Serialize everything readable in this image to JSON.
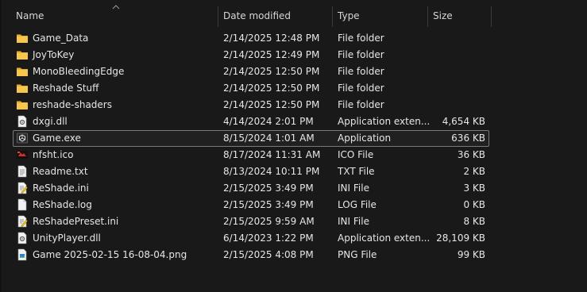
{
  "columns": {
    "name": "Name",
    "date": "Date modified",
    "type": "Type",
    "size": "Size"
  },
  "files": [
    {
      "name": "Game_Data",
      "date": "2/14/2025 12:48 PM",
      "type": "File folder",
      "size": "",
      "icon": "folder-icon"
    },
    {
      "name": "JoyToKey",
      "date": "2/14/2025 12:49 PM",
      "type": "File folder",
      "size": "",
      "icon": "folder-icon"
    },
    {
      "name": "MonoBleedingEdge",
      "date": "2/14/2025 12:50 PM",
      "type": "File folder",
      "size": "",
      "icon": "folder-icon"
    },
    {
      "name": "Reshade Stuff",
      "date": "2/14/2025 12:50 PM",
      "type": "File folder",
      "size": "",
      "icon": "folder-icon"
    },
    {
      "name": "reshade-shaders",
      "date": "2/14/2025 12:50 PM",
      "type": "File folder",
      "size": "",
      "icon": "folder-icon"
    },
    {
      "name": "dxgi.dll",
      "date": "4/14/2024 2:01 PM",
      "type": "Application exten...",
      "size": "4,654 KB",
      "icon": "dll-file-icon"
    },
    {
      "name": "Game.exe",
      "date": "8/15/2024 1:01 AM",
      "type": "Application",
      "size": "636 KB",
      "icon": "unity-app-icon"
    },
    {
      "name": "nfsht.ico",
      "date": "8/17/2024 11:31 AM",
      "type": "ICO File",
      "size": "36 KB",
      "icon": "ico-file-icon"
    },
    {
      "name": "Readme.txt",
      "date": "8/13/2024 10:11 PM",
      "type": "TXT File",
      "size": "2 KB",
      "icon": "text-file-icon"
    },
    {
      "name": "ReShade.ini",
      "date": "2/15/2025 3:49 PM",
      "type": "INI File",
      "size": "3 KB",
      "icon": "ini-file-icon"
    },
    {
      "name": "ReShade.log",
      "date": "2/15/2025 3:49 PM",
      "type": "LOG File",
      "size": "0 KB",
      "icon": "blank-file-icon"
    },
    {
      "name": "ReShadePreset.ini",
      "date": "2/15/2025 9:59 AM",
      "type": "INI File",
      "size": "8 KB",
      "icon": "ini-file-icon"
    },
    {
      "name": "UnityPlayer.dll",
      "date": "6/14/2023 1:22 PM",
      "type": "Application exten...",
      "size": "28,109 KB",
      "icon": "dll-file-icon"
    },
    {
      "name": "Game 2025-02-15 16-08-04.png",
      "date": "2/15/2025 4:08 PM",
      "type": "PNG File",
      "size": "99 KB",
      "icon": "image-file-icon"
    }
  ],
  "selected": "Game.exe",
  "colors": {
    "background": "#191919",
    "folder": "#f2c14e",
    "selection_border": "#7a7a7a"
  }
}
